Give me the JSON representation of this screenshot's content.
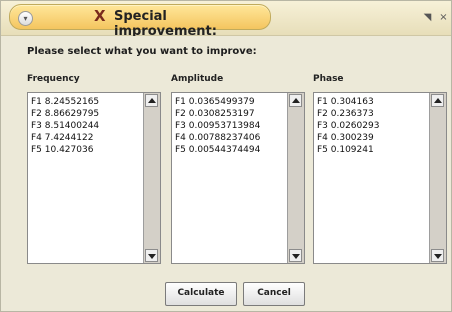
{
  "window": {
    "title": "Special improvement:",
    "close_glyph": "X",
    "min_glyph": "◥",
    "max_glyph": "×"
  },
  "prompt": "Please select what you want to improve:",
  "columns": [
    {
      "label": "Frequency",
      "items": [
        "F1 8.24552165",
        "F2 8.86629795",
        "F3 8.51400244",
        "F4 7.4244122",
        "F5 10.427036"
      ]
    },
    {
      "label": "Amplitude",
      "items": [
        "F1 0.0365499379",
        "F2 0.0308253197",
        "F3 0.00953713984",
        "F4 0.00788237406",
        "F5 0.00544374494"
      ]
    },
    {
      "label": "Phase",
      "items": [
        "F1 0.304163",
        "F2 0.236373",
        "F3 0.0260293",
        "F4 0.300239",
        "F5 0.109241"
      ]
    }
  ],
  "buttons": {
    "calculate": "Calculate",
    "cancel": "Cancel"
  },
  "icons": {
    "menu": "menu-icon",
    "close": "close-icon",
    "minimize": "minimize-icon",
    "scroll_up": "scroll-up-icon",
    "scroll_down": "scroll-down-icon"
  },
  "colors": {
    "title_tab": "#f4c55f",
    "window_bg": "#ece9d8",
    "list_bg": "#ffffff"
  }
}
